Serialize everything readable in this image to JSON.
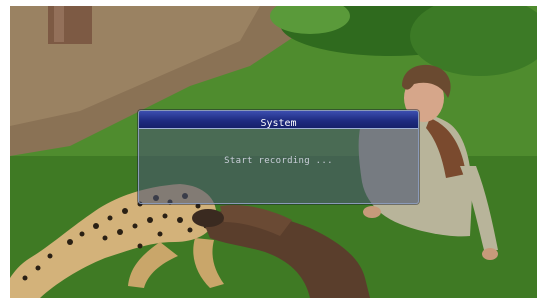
{
  "dialog": {
    "title": "System",
    "message": "Start recording ..."
  },
  "colors": {
    "title_bar": "#1f2c82",
    "panel": "#465270",
    "title_text": "#ffffff",
    "message_text": "#c9ced8"
  },
  "background": {
    "description_icon": "video-frame"
  }
}
